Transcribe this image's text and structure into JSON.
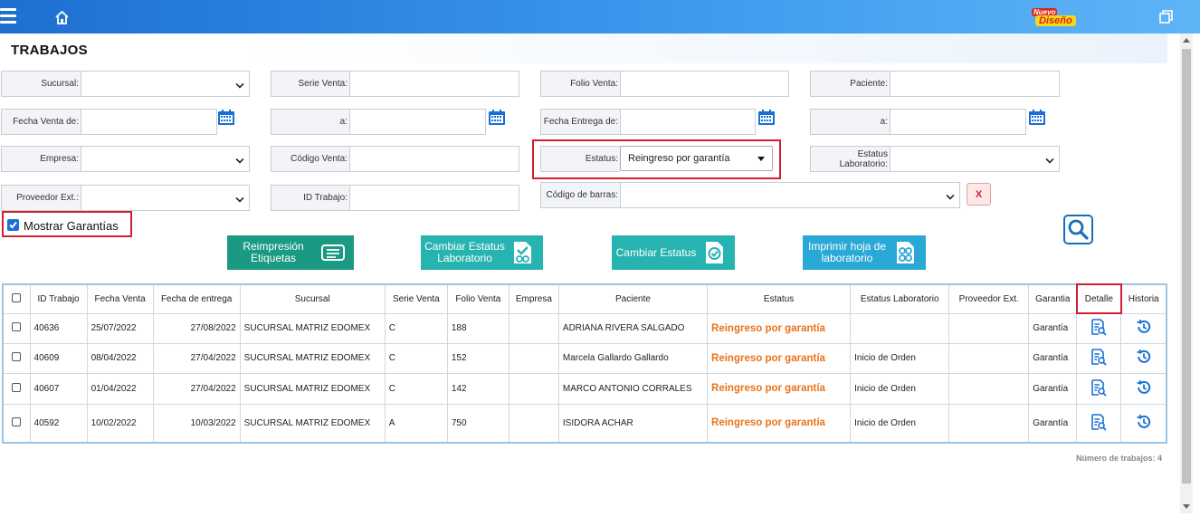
{
  "brand": {
    "line1": "Nuevo",
    "line2": "Diseño"
  },
  "page_title": "TRABAJOS",
  "filters": {
    "sucursal_label": "Sucursal:",
    "serie_venta_label": "Serie Venta:",
    "folio_venta_label": "Folio Venta:",
    "paciente_label": "Paciente:",
    "fecha_venta_de_label": "Fecha Venta de:",
    "a_label": "a:",
    "fecha_entrega_de_label": "Fecha Entrega de:",
    "a2_label": "a:",
    "empresa_label": "Empresa:",
    "codigo_venta_label": "Código Venta:",
    "estatus_label": "Estatus:",
    "estatus_value": "Reingreso por garantía",
    "estatus_lab_label": "Estatus Laboratorio:",
    "proveedor_label": "Proveedor Ext.:",
    "id_trabajo_label": "ID Trabajo:",
    "codigo_barras_label": "Código de barras:",
    "clear_label": "X"
  },
  "mostrar_garantias": {
    "label": "Mostrar Garantías",
    "checked": true
  },
  "actions": [
    {
      "label": "Reimpresión Etiquetas",
      "color": "#1a9a82"
    },
    {
      "label": "Cambiar Estatus Laboratorio",
      "color": "#27b3b0"
    },
    {
      "label": "Cambiar Estatus",
      "color": "#27b3b0"
    },
    {
      "label": "Imprimir hoja de laboratorio",
      "color": "#2aa9d6"
    }
  ],
  "table": {
    "headers": [
      "ID Trabajo",
      "Fecha Venta",
      "Fecha de entrega",
      "Sucursal",
      "Serie Venta",
      "Folio Venta",
      "Empresa",
      "Paciente",
      "Estatus",
      "Estatus Laboratorio",
      "Proveedor Ext.",
      "Garantia",
      "Detalle",
      "Historia"
    ],
    "rows": [
      {
        "id": "40636",
        "fecha_venta": "25/07/2022",
        "fecha_entrega": "27/08/2022",
        "sucursal": "SUCURSAL MATRIZ EDOMEX",
        "serie": "C",
        "folio": "188",
        "empresa": "",
        "paciente": "ADRIANA RIVERA SALGADO",
        "estatus": "Reingreso por garantía",
        "estatus_lab": "",
        "proveedor": "",
        "garantia": "Garantía"
      },
      {
        "id": "40609",
        "fecha_venta": "08/04/2022",
        "fecha_entrega": "27/04/2022",
        "sucursal": "SUCURSAL MATRIZ EDOMEX",
        "serie": "C",
        "folio": "152",
        "empresa": "",
        "paciente": "Marcela Gallardo Gallardo",
        "estatus": "Reingreso por garantía",
        "estatus_lab": "Inicio de Orden",
        "proveedor": "",
        "garantia": "Garantía"
      },
      {
        "id": "40607",
        "fecha_venta": "01/04/2022",
        "fecha_entrega": "27/04/2022",
        "sucursal": "SUCURSAL MATRIZ EDOMEX",
        "serie": "C",
        "folio": "142",
        "empresa": "",
        "paciente": "MARCO ANTONIO CORRALES",
        "estatus": "Reingreso por garantía",
        "estatus_lab": "Inicio de Orden",
        "proveedor": "",
        "garantia": "Garantía"
      },
      {
        "id": "40592",
        "fecha_venta": "10/02/2022",
        "fecha_entrega": "10/03/2022",
        "sucursal": "SUCURSAL MATRIZ EDOMEX",
        "serie": "A",
        "folio": "750",
        "empresa": "",
        "paciente": "ISIDORA ACHAR",
        "estatus": "Reingreso por garantía",
        "estatus_lab": "Inicio de Orden",
        "proveedor": "",
        "garantia": "Garantía"
      }
    ]
  },
  "count_label": "Número de trabajos: 4",
  "colors": {
    "accent": "#1a6fd4",
    "status_orange": "#e8731a",
    "highlight_red": "#d0202f"
  },
  "icons": [
    "hamburger-menu-icon",
    "home-icon",
    "restore-window-icon",
    "calendar-icon",
    "search-icon",
    "detail-icon",
    "history-icon"
  ]
}
